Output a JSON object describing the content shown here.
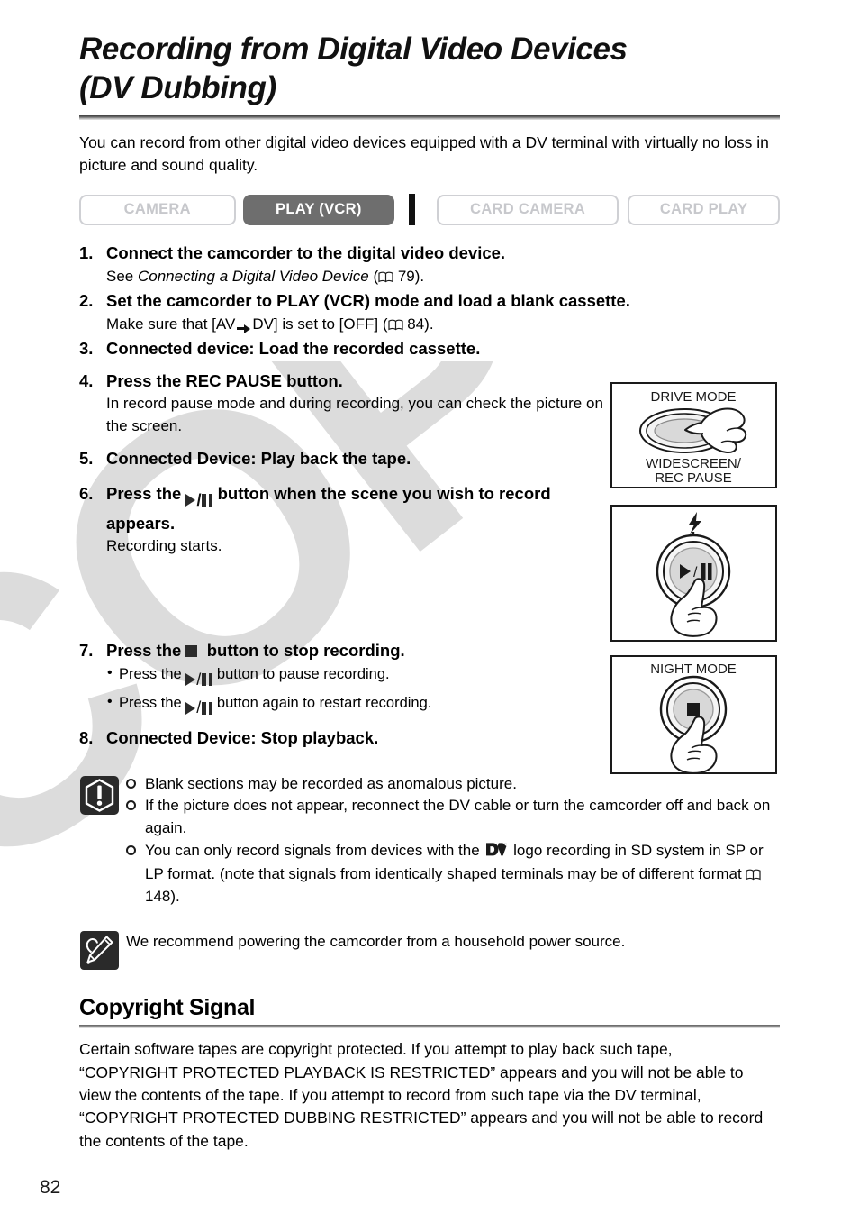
{
  "document": {
    "title": "Recording from Digital Video Devices (DV Dubbing)",
    "title_line1": "Recording from Digital Video Devices",
    "title_line2": "(DV Dubbing)",
    "intro": "You can record from other digital video devices equipped with a DV terminal with virtually no loss in picture and sound quality.",
    "page_number": "82"
  },
  "mode_bar": {
    "buttons": [
      {
        "label": "CAMERA",
        "active": false
      },
      {
        "label": "PLAY (VCR)",
        "active": true
      },
      {
        "label": "CARD CAMERA",
        "active": false
      },
      {
        "label": "CARD PLAY",
        "active": false
      }
    ],
    "active_color": "#6e6e6e",
    "inactive_border_color": "#cfd0d4",
    "inactive_text_color": "#c7c8cc"
  },
  "steps": [
    {
      "number": "1.",
      "heading": "Connect the camcorder to the digital video device.",
      "sub_pre": "See ",
      "sub_italic": "Connecting a Digital Video Device",
      "sub_post_open": " (",
      "page_ref": "79",
      "sub_post_close": ")."
    },
    {
      "number": "2.",
      "heading": "Set the camcorder to PLAY (VCR) mode and load a blank cassette.",
      "sub_a": "Make sure that [AV",
      "sub_b": "DV] is set to [OFF] (",
      "page_ref": "84",
      "sub_c": ")."
    },
    {
      "number": "3.",
      "heading": "Connected device: Load the recorded cassette."
    },
    {
      "number": "4.",
      "heading": "Press the REC PAUSE button.",
      "sub": "In record pause mode and during recording, you can check the picture on the screen."
    },
    {
      "number": "5.",
      "heading": "Connected Device: Play back the tape."
    },
    {
      "number": "6.",
      "heading_pre": "Press the ",
      "heading_post": " button when the scene you wish to record appears.",
      "sub": "Recording starts."
    },
    {
      "number": "7.",
      "heading_pre": "Press the ",
      "heading_post": " button to stop recording.",
      "bullets_pre": [
        "Press the ",
        "Press the "
      ],
      "bullets_post": [
        " button to pause recording.",
        " button again to restart recording."
      ]
    },
    {
      "number": "8.",
      "heading": "Connected Device: Stop playback."
    }
  ],
  "illustrations": [
    {
      "id": "drive-mode",
      "label_top": "DRIVE MODE",
      "label_bottom_line1": "WIDESCREEN/",
      "label_bottom_line2": "REC PAUSE",
      "button_type": "oval-blank"
    },
    {
      "id": "play-pause",
      "label_top": "",
      "icon_top": "flash-icon",
      "button_type": "round-play-pause"
    },
    {
      "id": "night-mode",
      "label_top": "NIGHT MODE",
      "button_type": "round-stop"
    }
  ],
  "notes": {
    "warning_icon": "warning-exclamation-icon",
    "items": [
      {
        "text": "Blank sections may be recorded as anomalous picture."
      },
      {
        "text": "If the picture does not appear, reconnect the DV cable or turn the camcorder off and back on again."
      },
      {
        "pre": "You can only record signals from devices with the ",
        "logo": "DV",
        "mid": " logo recording in SD system in SP or LP format. (note that signals from identically shaped terminals may be of different format ",
        "page_ref": "148",
        "post": ")."
      }
    ],
    "memo_icon": "pencil-memo-icon",
    "memo_text": "We recommend powering the camcorder from a household power source."
  },
  "copyright_section": {
    "title": "Copyright Signal",
    "body": "Certain software tapes are copyright protected. If you attempt to play back such tape, “COPYRIGHT PROTECTED PLAYBACK IS RESTRICTED” appears and you will not be able to view the contents of the tape. If you attempt to record from such tape via the DV terminal, “COPYRIGHT PROTECTED DUBBING RESTRICTED” appears and you will not be able to record the contents of the tape."
  },
  "watermark": {
    "text": "COPY",
    "color": "#dcdcdc"
  }
}
